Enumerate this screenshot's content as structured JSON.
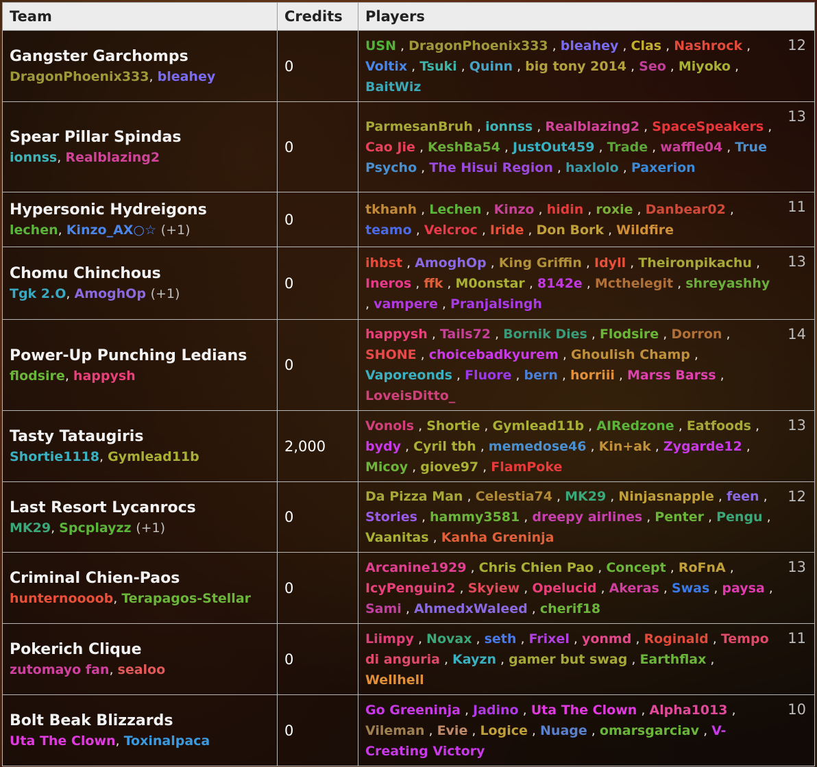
{
  "headers": {
    "team": "Team",
    "credits": "Credits",
    "players": "Players"
  },
  "teams": [
    {
      "name": "Gangster Garchomps",
      "captains": [
        {
          "name": "DragonPhoenix333",
          "color": "#9e9a3a"
        },
        {
          "name": "bleahey",
          "color": "#7a6cf2"
        }
      ],
      "extra": "",
      "credits": "0",
      "count": "12",
      "players": [
        {
          "name": "USN",
          "color": "#52b13b"
        },
        {
          "name": "DragonPhoenix333",
          "color": "#9e9a3a"
        },
        {
          "name": "bleahey",
          "color": "#7a6cf2"
        },
        {
          "name": "Clas",
          "color": "#c2b02e"
        },
        {
          "name": "Nashrock",
          "color": "#e24a3a"
        },
        {
          "name": "Voltix",
          "color": "#4a86e8"
        },
        {
          "name": "Tsuki",
          "color": "#3fb4a8"
        },
        {
          "name": "Quinn",
          "color": "#49a2c4"
        },
        {
          "name": "big tony 2014",
          "color": "#b2a13e"
        },
        {
          "name": "Seo",
          "color": "#c2409a"
        },
        {
          "name": "Miyoko",
          "color": "#a8b035"
        },
        {
          "name": "BaitWiz",
          "color": "#3ba8b8"
        }
      ]
    },
    {
      "name": "Spear Pillar Spindas",
      "captains": [
        {
          "name": "ionnss",
          "color": "#3fb4b8"
        },
        {
          "name": "Realblazing2",
          "color": "#d0449a"
        }
      ],
      "extra": "",
      "credits": "0",
      "count": "13",
      "players": [
        {
          "name": "ParmesanBruh",
          "color": "#a6a93a"
        },
        {
          "name": "ionnss",
          "color": "#3fb4b8"
        },
        {
          "name": "Realblazing2",
          "color": "#d0449a"
        },
        {
          "name": "SpaceSpeakers",
          "color": "#e8373a"
        },
        {
          "name": "Cao Jie",
          "color": "#e8405a"
        },
        {
          "name": "KeshBa54",
          "color": "#6aad3c"
        },
        {
          "name": "JustOut459",
          "color": "#38b0c0"
        },
        {
          "name": "Trade",
          "color": "#5ea63a"
        },
        {
          "name": "waffle04",
          "color": "#c8409a"
        },
        {
          "name": "True Psycho",
          "color": "#4a90d0"
        },
        {
          "name": "The Hisui Region",
          "color": "#9b4ae0"
        },
        {
          "name": "haxlolo",
          "color": "#3a9aa8"
        },
        {
          "name": "Paxerion",
          "color": "#3a8ad8"
        }
      ]
    },
    {
      "name": "Hypersonic Hydreigons",
      "captains": [
        {
          "name": "lechen",
          "color": "#5ab53a"
        },
        {
          "name": "Kinzo_AX○☆",
          "color": "#4a86e8"
        }
      ],
      "extra": "(+1)",
      "credits": "0",
      "count": "11",
      "players": [
        {
          "name": "tkhanh",
          "color": "#c08a3a"
        },
        {
          "name": "Lechen",
          "color": "#5ab53a"
        },
        {
          "name": "Kinzo",
          "color": "#c8409a"
        },
        {
          "name": "hidin",
          "color": "#e83a3a"
        },
        {
          "name": "roxie",
          "color": "#7ab03a"
        },
        {
          "name": "Danbear02",
          "color": "#d04a3a"
        },
        {
          "name": "teamo",
          "color": "#4a6ae8"
        },
        {
          "name": "Velcroc",
          "color": "#e83a4a"
        },
        {
          "name": "Iride",
          "color": "#e8503a"
        },
        {
          "name": "Don Bork",
          "color": "#c0a03a"
        },
        {
          "name": "Wildfire",
          "color": "#d0903a"
        }
      ]
    },
    {
      "name": "Chomu Chinchous",
      "captains": [
        {
          "name": "Tgk 2.O",
          "color": "#3aa8c0"
        },
        {
          "name": "AmoghOp",
          "color": "#8a6ae0"
        }
      ],
      "extra": "(+1)",
      "credits": "0",
      "count": "13",
      "players": [
        {
          "name": "ihbst",
          "color": "#e84a3a"
        },
        {
          "name": "AmoghOp",
          "color": "#8a6ae0"
        },
        {
          "name": "King Griffin",
          "color": "#b0903a"
        },
        {
          "name": "Idyll",
          "color": "#e8503a"
        },
        {
          "name": "Theironpikachu",
          "color": "#a6a93a"
        },
        {
          "name": "Ineros",
          "color": "#e83a8a"
        },
        {
          "name": "ffk",
          "color": "#e0603a"
        },
        {
          "name": "M0onstar",
          "color": "#a8b035"
        },
        {
          "name": "8142e",
          "color": "#c03ae0"
        },
        {
          "name": "Mcthelegit",
          "color": "#b0703a"
        },
        {
          "name": "shreyashhy",
          "color": "#6aad3c"
        },
        {
          "name": "vampere",
          "color": "#b03ae0"
        },
        {
          "name": "Pranjalsingh",
          "color": "#a83ae8"
        }
      ]
    },
    {
      "name": "Power-Up Punching Ledians",
      "captains": [
        {
          "name": "flodsire",
          "color": "#6ab53a"
        },
        {
          "name": "happysh",
          "color": "#e8407a"
        }
      ],
      "extra": "",
      "credits": "0",
      "count": "14",
      "players": [
        {
          "name": "happysh",
          "color": "#e8407a"
        },
        {
          "name": "Tails72",
          "color": "#c8409a"
        },
        {
          "name": "Bornik Dies",
          "color": "#3a9a7a"
        },
        {
          "name": "Flodsire",
          "color": "#6ab53a"
        },
        {
          "name": "Dorron",
          "color": "#b0703a"
        },
        {
          "name": "SHONE",
          "color": "#e84a4a"
        },
        {
          "name": "choicebadkyurem",
          "color": "#c83ae8"
        },
        {
          "name": "Ghoulish Champ",
          "color": "#c0903a"
        },
        {
          "name": "Vaporeonds",
          "color": "#3ab0c0"
        },
        {
          "name": "Fluore",
          "color": "#9a3ae8"
        },
        {
          "name": "bern",
          "color": "#4a80d8"
        },
        {
          "name": "horriii",
          "color": "#e0903a"
        },
        {
          "name": "Marss Barss",
          "color": "#e040b0"
        },
        {
          "name": "LoveisDitto_",
          "color": "#d0407a"
        }
      ]
    },
    {
      "name": "Tasty Tataugiris",
      "captains": [
        {
          "name": "Shortie1118",
          "color": "#3ab0c0"
        },
        {
          "name": "Gymlead11b",
          "color": "#a8b035"
        }
      ],
      "extra": "",
      "credits": "2,000",
      "count": "13",
      "players": [
        {
          "name": "Vonols",
          "color": "#d0407a"
        },
        {
          "name": "Shortie",
          "color": "#a8b035"
        },
        {
          "name": "Gymlead11b",
          "color": "#a8b035"
        },
        {
          "name": "AIRedzone",
          "color": "#5ab53a"
        },
        {
          "name": "Eatfoods",
          "color": "#a6a93a"
        },
        {
          "name": "bydy",
          "color": "#c83ae8"
        },
        {
          "name": "Cyril tbh",
          "color": "#a8b035"
        },
        {
          "name": "memedose46",
          "color": "#4a90d0"
        },
        {
          "name": "Kin+ak",
          "color": "#c0903a"
        },
        {
          "name": "Zygarde12",
          "color": "#c83ae8"
        },
        {
          "name": "Micoy",
          "color": "#6ab53a"
        },
        {
          "name": "giove97",
          "color": "#a8b035"
        },
        {
          "name": "FlamPoke",
          "color": "#e83a3a"
        }
      ]
    },
    {
      "name": "Last Resort Lycanrocs",
      "captains": [
        {
          "name": "MK29",
          "color": "#3aa87a"
        },
        {
          "name": "Spcplayzz",
          "color": "#5ab53a"
        }
      ],
      "extra": "(+1)",
      "credits": "0",
      "count": "12",
      "players": [
        {
          "name": "Da Pizza Man",
          "color": "#a6a93a"
        },
        {
          "name": "Celestia74",
          "color": "#b08a3a"
        },
        {
          "name": "MK29",
          "color": "#3aa87a"
        },
        {
          "name": "Ninjasnapple",
          "color": "#c0a03a"
        },
        {
          "name": "feen",
          "color": "#8a6ae0"
        },
        {
          "name": "Stories",
          "color": "#9a5ae8"
        },
        {
          "name": "hammy3581",
          "color": "#6ab53a"
        },
        {
          "name": "dreepy airlines",
          "color": "#c840b0"
        },
        {
          "name": "Penter",
          "color": "#6ab53a"
        },
        {
          "name": "Pengu",
          "color": "#3aa87a"
        },
        {
          "name": "Vaanitas",
          "color": "#a8b035"
        },
        {
          "name": "Kanha Greninja",
          "color": "#e0603a"
        }
      ]
    },
    {
      "name": "Criminal Chien-Paos",
      "captains": [
        {
          "name": "hunternoooob",
          "color": "#e8503a"
        },
        {
          "name": "Terapagos-Stellar",
          "color": "#6ab53a"
        }
      ],
      "extra": "",
      "credits": "0",
      "count": "13",
      "players": [
        {
          "name": "Arcanine1929",
          "color": "#e04090"
        },
        {
          "name": "Chris Chien Pao",
          "color": "#a8b035"
        },
        {
          "name": "Concept",
          "color": "#6ab53a"
        },
        {
          "name": "RoFnA",
          "color": "#c0a03a"
        },
        {
          "name": "IcyPenguin2",
          "color": "#e8407a"
        },
        {
          "name": "Skyiew",
          "color": "#e04a5a"
        },
        {
          "name": "Opelucid",
          "color": "#e8407a"
        },
        {
          "name": "Akeras",
          "color": "#d040a0"
        },
        {
          "name": "Swas",
          "color": "#3a7ae8"
        },
        {
          "name": "paysa",
          "color": "#e03ab0"
        },
        {
          "name": "Sami",
          "color": "#c040a0"
        },
        {
          "name": "AhmedxWaleed",
          "color": "#8a6ae0"
        },
        {
          "name": "cherif18",
          "color": "#6ab53a"
        }
      ]
    },
    {
      "name": "Pokerich Clique",
      "captains": [
        {
          "name": "zutomayo fan",
          "color": "#d040a0"
        },
        {
          "name": "sealoo",
          "color": "#e05a5a"
        }
      ],
      "extra": "",
      "credits": "0",
      "count": "11",
      "players": [
        {
          "name": "Liimpy",
          "color": "#e0407a"
        },
        {
          "name": "Novax",
          "color": "#3aa87a"
        },
        {
          "name": "seth",
          "color": "#4a7ae8"
        },
        {
          "name": "Frixel",
          "color": "#b040e0"
        },
        {
          "name": "yonmd",
          "color": "#e04a8a"
        },
        {
          "name": "Roginald",
          "color": "#e04a3a"
        },
        {
          "name": "Tempo di anguria",
          "color": "#e04a6a"
        },
        {
          "name": "Kayzn",
          "color": "#3ab0c0"
        },
        {
          "name": "gamer but swag",
          "color": "#a6a93a"
        },
        {
          "name": "Earthflax",
          "color": "#6ab53a"
        },
        {
          "name": "Wellhell",
          "color": "#e0903a"
        }
      ]
    },
    {
      "name": "Bolt Beak Blizzards",
      "captains": [
        {
          "name": "Uta The Clown",
          "color": "#e03ae0"
        },
        {
          "name": "Toxinalpaca",
          "color": "#3a9ae0"
        }
      ],
      "extra": "",
      "credits": "0",
      "count": "10",
      "players": [
        {
          "name": "Go Greeninja",
          "color": "#c83ae8"
        },
        {
          "name": "Jadino",
          "color": "#b03ae8"
        },
        {
          "name": "Uta The Clown",
          "color": "#e03ae0"
        },
        {
          "name": "Alpha1013",
          "color": "#e04a9a"
        },
        {
          "name": "Vileman",
          "color": "#a08050"
        },
        {
          "name": "Evie",
          "color": "#c08a6a"
        },
        {
          "name": "Logice",
          "color": "#c0a03a"
        },
        {
          "name": "Nuage",
          "color": "#5a80d0"
        },
        {
          "name": "omarsgarciav",
          "color": "#6ab53a"
        },
        {
          "name": "V-Creating Victory",
          "color": "#c83ae8"
        }
      ]
    }
  ]
}
